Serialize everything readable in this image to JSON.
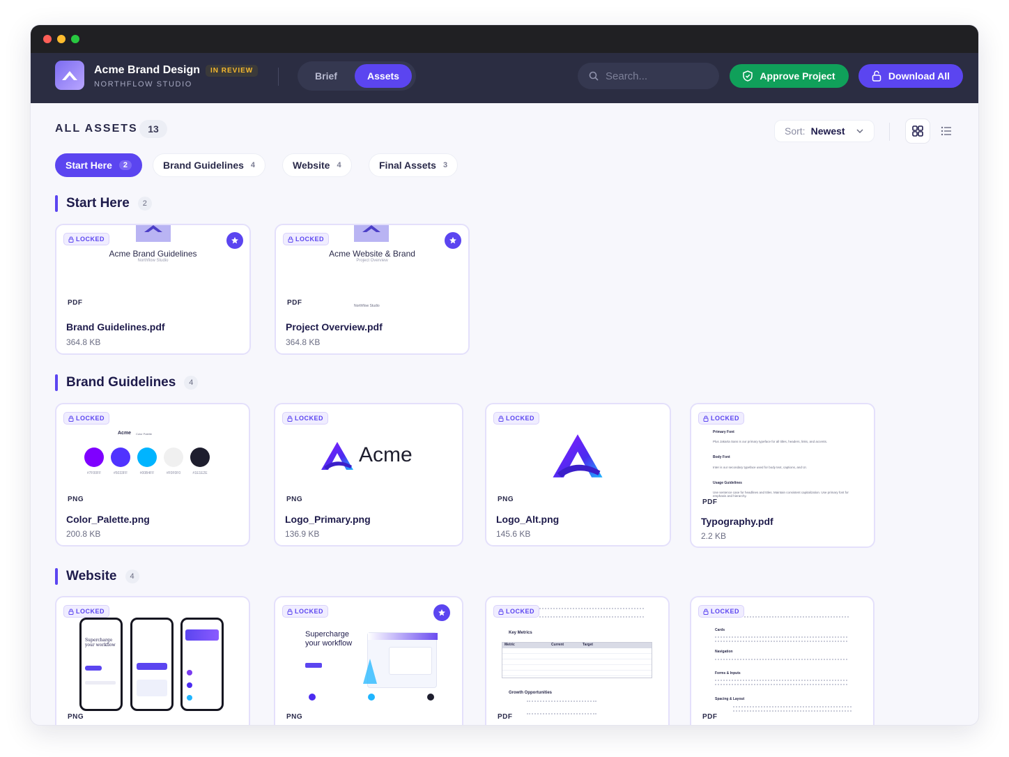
{
  "header": {
    "project_title": "Acme Brand Design",
    "studio": "NORTHFLOW STUDIO",
    "status_badge": "IN REVIEW",
    "tabs": [
      "Brief",
      "Assets"
    ],
    "active_tab": "Assets",
    "search_placeholder": "Search...",
    "approve_label": "Approve Project",
    "download_label": "Download All"
  },
  "toolbar": {
    "all_assets_label": "ALL ASSETS",
    "all_assets_count": "13",
    "sort_label": "Sort:",
    "sort_value": "Newest"
  },
  "filters": [
    {
      "label": "Start Here",
      "count": "2",
      "active": true
    },
    {
      "label": "Brand Guidelines",
      "count": "4"
    },
    {
      "label": "Website",
      "count": "4"
    },
    {
      "label": "Final Assets",
      "count": "3"
    }
  ],
  "locked_label": "LOCKED",
  "sections": [
    {
      "title": "Start Here",
      "count": "2",
      "cards": [
        {
          "type": "PDF",
          "name": "Brand Guidelines.pdf",
          "size": "364.8 KB",
          "preview_title": "Acme Brand Guidelines",
          "preview_sub": "Northflow Studio",
          "starred": true
        },
        {
          "type": "PDF",
          "name": "Project Overview.pdf",
          "size": "364.8 KB",
          "preview_title": "Acme Website & Brand",
          "preview_sub": "Project Overview",
          "preview_footer": "Northflow Studio",
          "starred": true
        }
      ]
    },
    {
      "title": "Brand Guidelines",
      "count": "4",
      "cards": [
        {
          "type": "PNG",
          "name": "Color_Palette.png",
          "size": "200.8 KB",
          "preview_title": "Acme",
          "preview_sub": "Color Palette",
          "swatches": [
            {
              "hex": "#7F00FF",
              "label": "#7F00FF"
            },
            {
              "hex": "#5033FF",
              "label": "#5033FF"
            },
            {
              "hex": "#00B4FF",
              "label": "#00B4FF"
            },
            {
              "hex": "#F0F0F0",
              "label": "#F0F0F0"
            },
            {
              "hex": "#1E1E2E",
              "label": "#1E1E2E"
            }
          ]
        },
        {
          "type": "PNG",
          "name": "Logo_Primary.png",
          "size": "136.9 KB",
          "wordmark": "Acme"
        },
        {
          "type": "PNG",
          "name": "Logo_Alt.png",
          "size": "145.6 KB"
        },
        {
          "type": "PDF",
          "name": "Typography.pdf",
          "size": "2.2 KB",
          "doc_lines": [
            {
              "h": "Primary Font",
              "p": "Plus Jakarta Sans is our primary typeface for all titles, headers, links, and accents."
            },
            {
              "h": "Body Font",
              "p": "Inter is our secondary typeface used for body text, captions, and UI."
            },
            {
              "h": "Usage Guidelines",
              "p": "Use sentence case for headlines and titles. Maintain consistent capitalization. Use primary font for emphasis and hierarchy."
            }
          ]
        }
      ]
    },
    {
      "title": "Website",
      "count": "4",
      "cards": [
        {
          "type": "PNG",
          "name": "",
          "size": "",
          "phone_text": "Supercharge your workflow"
        },
        {
          "type": "PNG",
          "name": "",
          "size": "",
          "hero_text": "Supercharge your workflow",
          "starred": true
        },
        {
          "type": "PDF",
          "name": "",
          "size": "",
          "doc_h1": "Key Metrics",
          "doc_h2": "Growth Opportunities",
          "table_head": [
            "Metric",
            "Current",
            "Target"
          ]
        },
        {
          "type": "PDF",
          "name": "",
          "size": "",
          "doc_heads": [
            "Cards",
            "Navigation",
            "Forms & Inputs",
            "Spacing & Layout"
          ]
        }
      ]
    }
  ],
  "colors": {
    "accent": "#5b45f0",
    "approve": "#10a05a",
    "header_bg": "#2b2d42",
    "review": "#f5b82e"
  }
}
